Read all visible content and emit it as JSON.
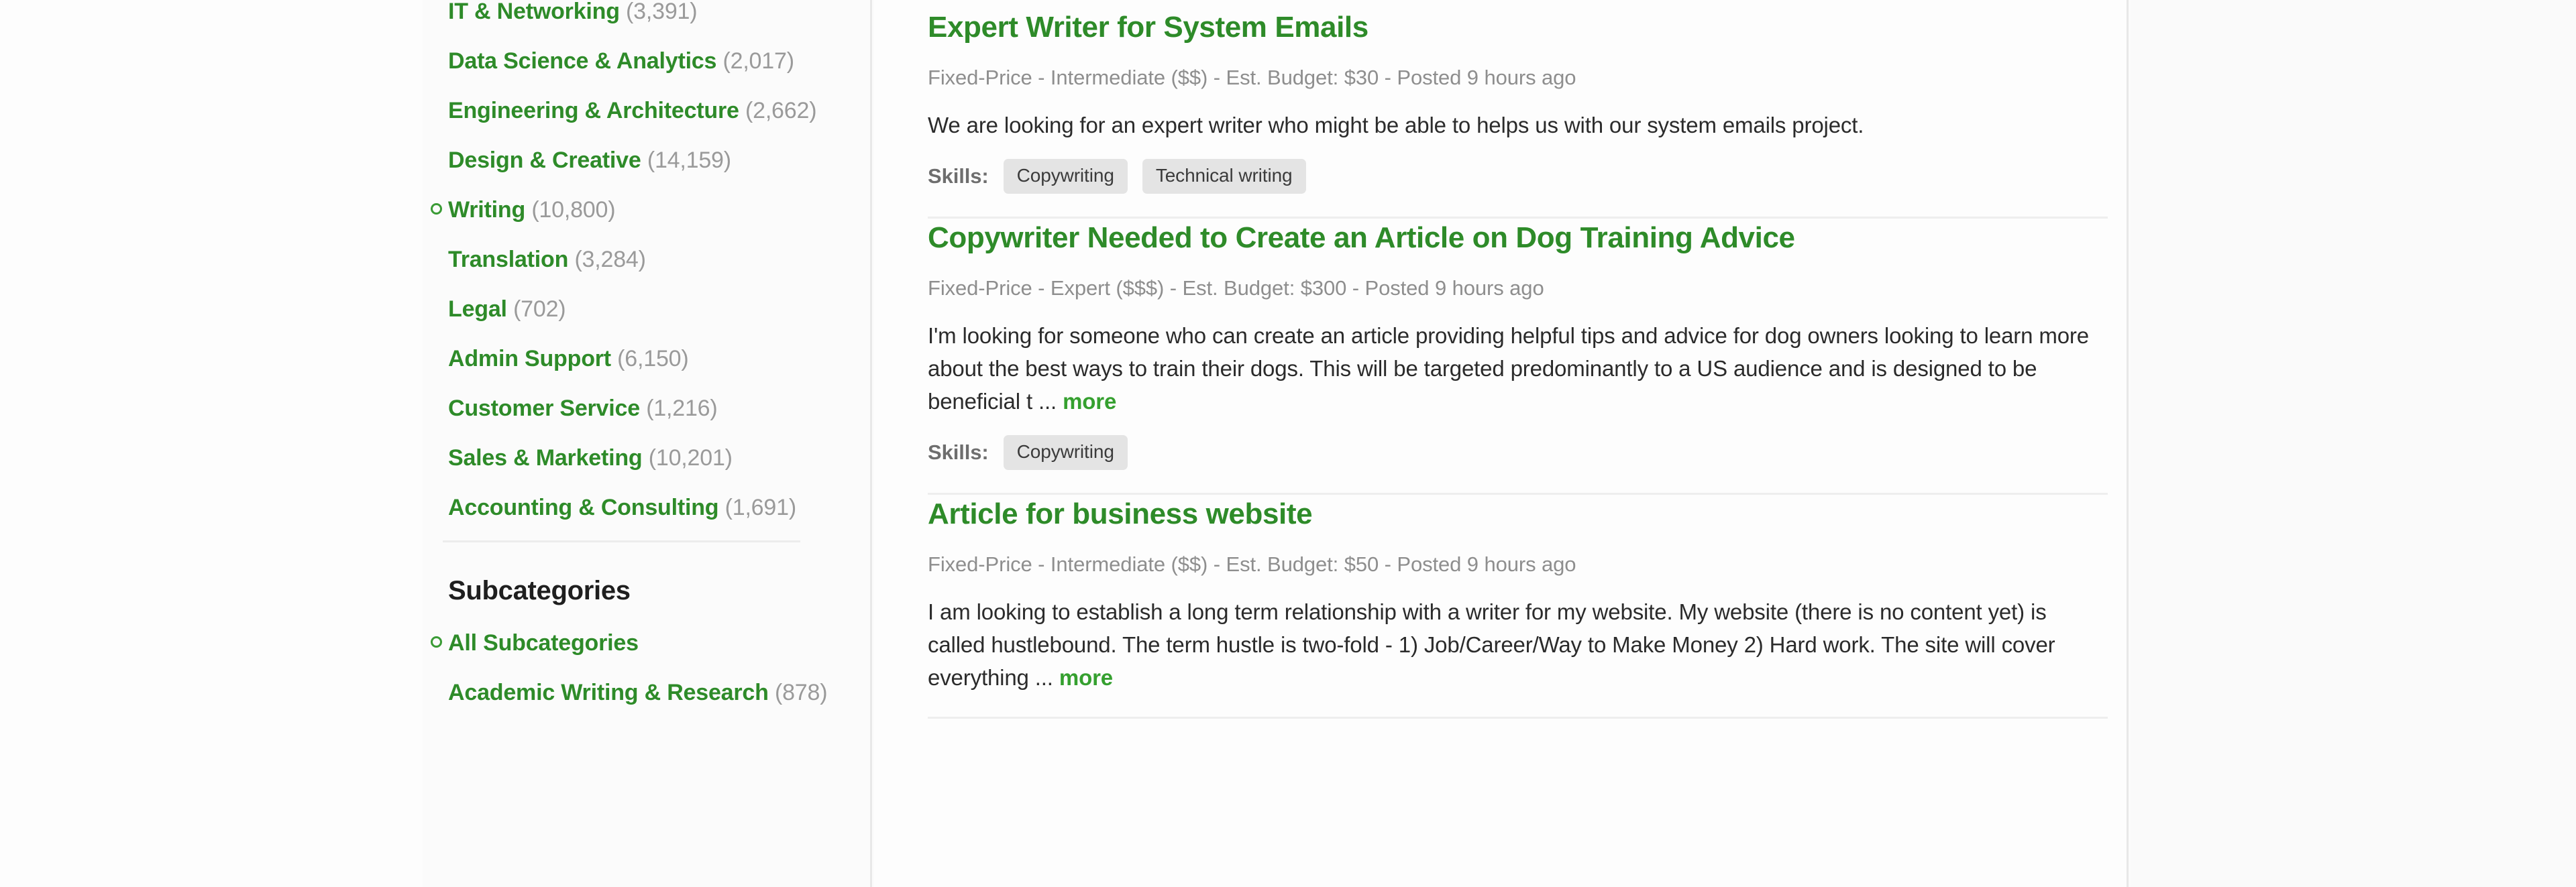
{
  "theme": {
    "link_green": "#2e8b29",
    "count_gray": "#9a9a9a",
    "meta_gray": "#8e8e8e",
    "tag_bg": "#e4e4e4",
    "page_bg": "#fbfbfb"
  },
  "sidebar": {
    "categories": [
      {
        "name": "IT & Networking",
        "count": "(3,391)",
        "selected": false
      },
      {
        "name": "Data Science & Analytics",
        "count": "(2,017)",
        "selected": false
      },
      {
        "name": "Engineering & Architecture",
        "count": "(2,662)",
        "selected": false
      },
      {
        "name": "Design & Creative",
        "count": "(14,159)",
        "selected": false
      },
      {
        "name": "Writing",
        "count": "(10,800)",
        "selected": true
      },
      {
        "name": "Translation",
        "count": "(3,284)",
        "selected": false
      },
      {
        "name": "Legal",
        "count": "(702)",
        "selected": false
      },
      {
        "name": "Admin Support",
        "count": "(6,150)",
        "selected": false
      },
      {
        "name": "Customer Service",
        "count": "(1,216)",
        "selected": false
      },
      {
        "name": "Sales & Marketing",
        "count": "(10,201)",
        "selected": false
      },
      {
        "name": "Accounting & Consulting",
        "count": "(1,691)",
        "selected": false
      }
    ],
    "subcategories_heading": "Subcategories",
    "subcategories": [
      {
        "name": "All Subcategories",
        "count": "",
        "selected": true
      },
      {
        "name": "Academic Writing & Research",
        "count": "(878)",
        "selected": false
      }
    ]
  },
  "jobs": [
    {
      "title": "Expert Writer for System Emails",
      "meta": "Fixed-Price - Intermediate ($$) - Est. Budget: $30 - Posted 9 hours ago",
      "description": "We are looking for an expert writer who might be able to helps us with our system emails project.",
      "truncated": false,
      "more_label": "",
      "skills_label": "Skills:",
      "skills": [
        "Copywriting",
        "Technical writing"
      ]
    },
    {
      "title": "Copywriter Needed to Create an Article on Dog Training Advice",
      "meta": "Fixed-Price - Expert ($$$) - Est. Budget: $300 - Posted 9 hours ago",
      "description": "I'm looking for someone who can create an article providing helpful tips and advice for dog owners looking to learn more about the best ways to train their dogs. This will be targeted predominantly to a US audience and is designed to be beneficial t ...",
      "truncated": true,
      "more_label": "more",
      "skills_label": "Skills:",
      "skills": [
        "Copywriting"
      ]
    },
    {
      "title": "Article for business website",
      "meta": "Fixed-Price - Intermediate ($$) - Est. Budget: $50 - Posted 9 hours ago",
      "description": "I am looking to establish a long term relationship with a writer for my website. My website (there is no content yet) is called hustlebound. The term hustle is two-fold - 1) Job/Career/Way to Make Money 2) Hard work. The site will cover everything ...",
      "truncated": true,
      "more_label": "more",
      "skills_label": "",
      "skills": []
    }
  ]
}
